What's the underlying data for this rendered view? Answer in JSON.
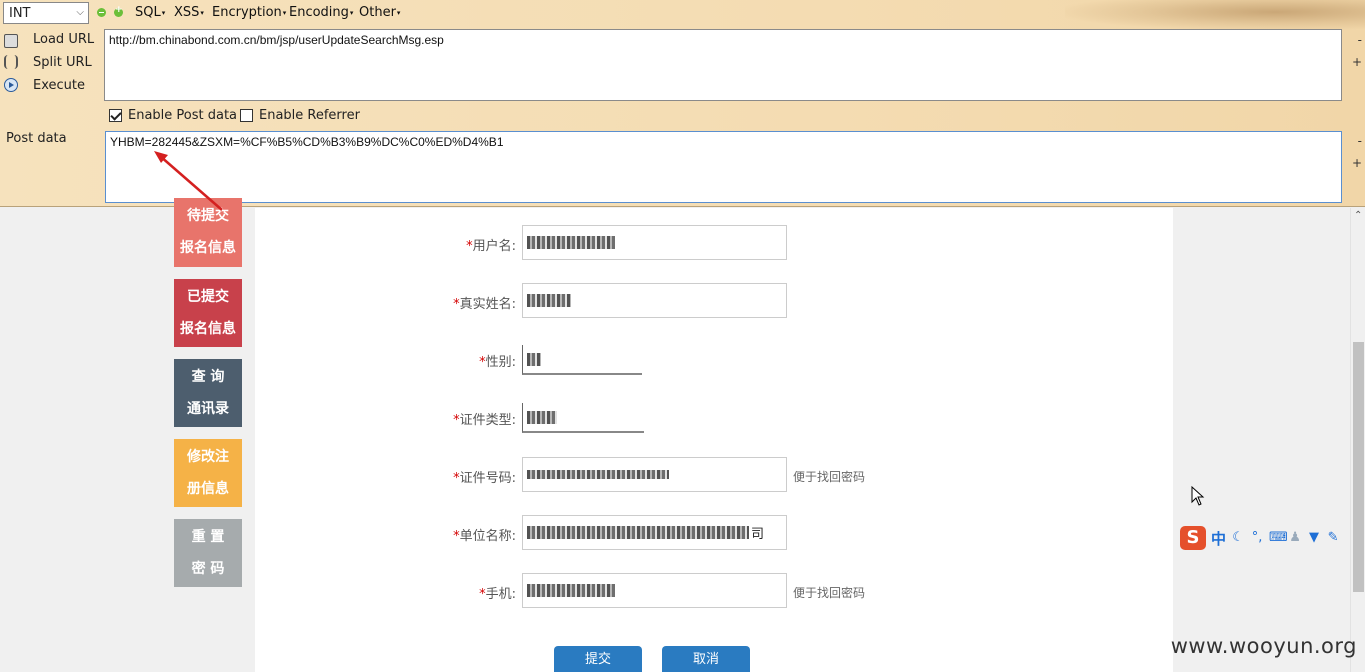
{
  "hackbar": {
    "select_value": "INT",
    "menus": [
      "SQL",
      "XSS",
      "Encryption",
      "Encoding",
      "Other"
    ],
    "actions": {
      "load_url": "Load URL",
      "split_url": "Split URL",
      "execute": "Execute"
    },
    "url": "http://bm.chinabond.com.cn/bm/jsp/userUpdateSearchMsg.esp",
    "enable_post_label": "Enable Post data",
    "enable_referrer_label": "Enable Referrer",
    "enable_post_checked": true,
    "enable_referrer_checked": false,
    "post_label": "Post data",
    "post_data": "YHBM=282445&ZSXM=%CF%B5%CD%B3%B9%DC%C0%ED%D4%B1",
    "minus": "-",
    "plus": "+"
  },
  "sidebar": {
    "items": [
      {
        "line1": "待提交",
        "line2": "报名信息",
        "color": "#e8746b"
      },
      {
        "line1": "已提交",
        "line2": "报名信息",
        "color": "#c8414b"
      },
      {
        "line1": "查 询",
        "line2": "通讯录",
        "color": "#4d5e6e"
      },
      {
        "line1": "修改注",
        "line2": "册信息",
        "color": "#f5b247"
      },
      {
        "line1": "重 置",
        "line2": "密 码",
        "color": "#a6abad"
      }
    ]
  },
  "form": {
    "required_mark": "*",
    "username_label": "用户名:",
    "realname_label": "真实姓名:",
    "gender_label": "性别:",
    "idtype_label": "证件类型:",
    "idnumber_label": "证件号码:",
    "company_label": "单位名称:",
    "phone_label": "手机:",
    "company_suffix": "司",
    "hint_idnumber": "便于找回密码",
    "hint_phone": "便于找回密码",
    "submit_label": "提交",
    "cancel_label": "取消"
  },
  "ime": {
    "logo": "S",
    "mode": "中"
  },
  "watermark": "www.wooyun.org"
}
